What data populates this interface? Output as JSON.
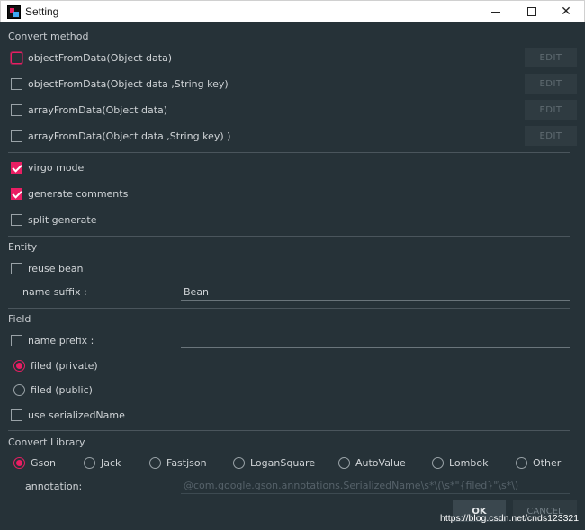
{
  "window": {
    "title": "Setting",
    "icon": "intellij-app-icon",
    "controls": [
      "minimize-icon",
      "maximize-icon",
      "close-icon"
    ]
  },
  "convert_method": {
    "label": "Convert method",
    "items": [
      {
        "label": "objectFromData(Object data)",
        "checked": false,
        "focused": true,
        "edit_label": "EDIT"
      },
      {
        "label": "objectFromData(Object data ,String key)",
        "checked": false,
        "edit_label": "EDIT"
      },
      {
        "label": "arrayFromData(Object data)",
        "checked": false,
        "edit_label": "EDIT"
      },
      {
        "label": "arrayFromData(Object data ,String key) )",
        "checked": false,
        "edit_label": "EDIT"
      }
    ]
  },
  "options": {
    "virgo_mode": {
      "label": "virgo mode",
      "checked": true
    },
    "generate_comments": {
      "label": "generate comments",
      "checked": true
    },
    "split_generate": {
      "label": "split generate",
      "checked": false
    }
  },
  "entity": {
    "label": "Entity",
    "reuse_bean": {
      "label": "reuse bean",
      "checked": false
    },
    "name_suffix_label": "name suffix :",
    "name_suffix_value": "Bean"
  },
  "field": {
    "label": "Field",
    "name_prefix": {
      "label": "name prefix :",
      "checked": false,
      "value": ""
    },
    "filed_private": {
      "label": "filed (private)",
      "selected": true
    },
    "filed_public": {
      "label": "filed (public)",
      "selected": false
    },
    "use_serialized_name": {
      "label": "use serializedName",
      "checked": false
    }
  },
  "convert_library": {
    "label": "Convert Library",
    "options": [
      {
        "label": "Gson",
        "selected": true
      },
      {
        "label": "Jack",
        "selected": false
      },
      {
        "label": "Fastjson",
        "selected": false
      },
      {
        "label": "LoganSquare",
        "selected": false
      },
      {
        "label": "AutoValue",
        "selected": false
      },
      {
        "label": "Lombok",
        "selected": false
      },
      {
        "label": "Other",
        "selected": false
      }
    ],
    "annotation_label": "annotation:",
    "annotation_value": "@com.google.gson.annotations.SerializedName\\s*\\(\\s*\"{filed}\"\\s*\\)"
  },
  "footer": {
    "ok_label": "OK",
    "cancel_label": "CANCEL",
    "watermark": "https://blog.csdn.net/cnds123321"
  },
  "colors": {
    "background": "#263238",
    "accent": "#e91e63",
    "text": "#c9cdd1"
  }
}
